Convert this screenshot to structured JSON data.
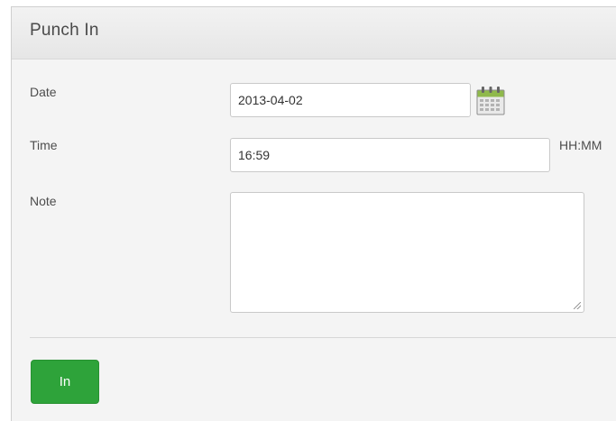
{
  "panel": {
    "title": "Punch In"
  },
  "form": {
    "date": {
      "label": "Date",
      "value": "2013-04-02"
    },
    "time": {
      "label": "Time",
      "value": "16:59",
      "hint": "HH:MM"
    },
    "note": {
      "label": "Note",
      "value": ""
    }
  },
  "actions": {
    "in_label": "In"
  },
  "colors": {
    "button": "#2ea33a",
    "panel_background": "#f4f4f4",
    "header_background": "#ececec"
  },
  "icons": {
    "calendar": "calendar-icon"
  }
}
